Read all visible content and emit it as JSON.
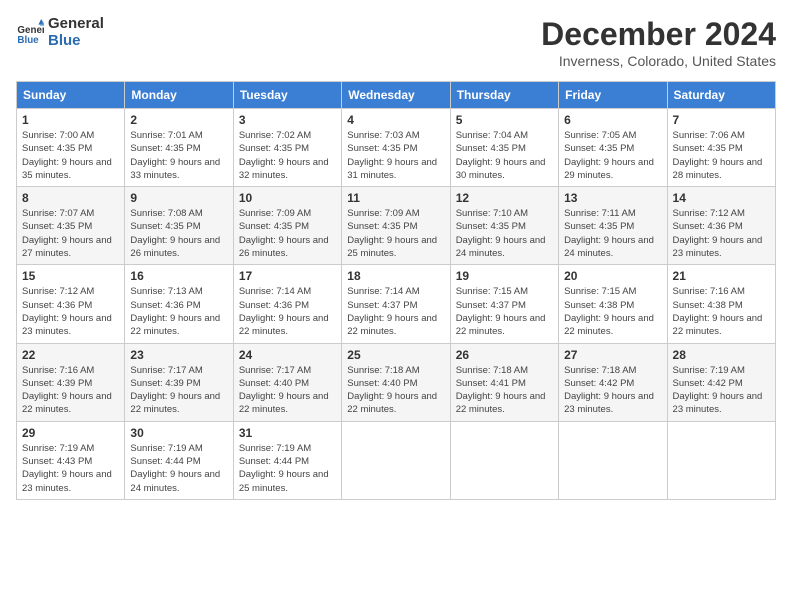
{
  "header": {
    "logo_line1": "General",
    "logo_line2": "Blue",
    "month": "December 2024",
    "location": "Inverness, Colorado, United States"
  },
  "weekdays": [
    "Sunday",
    "Monday",
    "Tuesday",
    "Wednesday",
    "Thursday",
    "Friday",
    "Saturday"
  ],
  "weeks": [
    [
      {
        "day": 1,
        "sunrise": "7:00 AM",
        "sunset": "4:35 PM",
        "daylight": "9 hours and 35 minutes."
      },
      {
        "day": 2,
        "sunrise": "7:01 AM",
        "sunset": "4:35 PM",
        "daylight": "9 hours and 33 minutes."
      },
      {
        "day": 3,
        "sunrise": "7:02 AM",
        "sunset": "4:35 PM",
        "daylight": "9 hours and 32 minutes."
      },
      {
        "day": 4,
        "sunrise": "7:03 AM",
        "sunset": "4:35 PM",
        "daylight": "9 hours and 31 minutes."
      },
      {
        "day": 5,
        "sunrise": "7:04 AM",
        "sunset": "4:35 PM",
        "daylight": "9 hours and 30 minutes."
      },
      {
        "day": 6,
        "sunrise": "7:05 AM",
        "sunset": "4:35 PM",
        "daylight": "9 hours and 29 minutes."
      },
      {
        "day": 7,
        "sunrise": "7:06 AM",
        "sunset": "4:35 PM",
        "daylight": "9 hours and 28 minutes."
      }
    ],
    [
      {
        "day": 8,
        "sunrise": "7:07 AM",
        "sunset": "4:35 PM",
        "daylight": "9 hours and 27 minutes."
      },
      {
        "day": 9,
        "sunrise": "7:08 AM",
        "sunset": "4:35 PM",
        "daylight": "9 hours and 26 minutes."
      },
      {
        "day": 10,
        "sunrise": "7:09 AM",
        "sunset": "4:35 PM",
        "daylight": "9 hours and 26 minutes."
      },
      {
        "day": 11,
        "sunrise": "7:09 AM",
        "sunset": "4:35 PM",
        "daylight": "9 hours and 25 minutes."
      },
      {
        "day": 12,
        "sunrise": "7:10 AM",
        "sunset": "4:35 PM",
        "daylight": "9 hours and 24 minutes."
      },
      {
        "day": 13,
        "sunrise": "7:11 AM",
        "sunset": "4:35 PM",
        "daylight": "9 hours and 24 minutes."
      },
      {
        "day": 14,
        "sunrise": "7:12 AM",
        "sunset": "4:36 PM",
        "daylight": "9 hours and 23 minutes."
      }
    ],
    [
      {
        "day": 15,
        "sunrise": "7:12 AM",
        "sunset": "4:36 PM",
        "daylight": "9 hours and 23 minutes."
      },
      {
        "day": 16,
        "sunrise": "7:13 AM",
        "sunset": "4:36 PM",
        "daylight": "9 hours and 22 minutes."
      },
      {
        "day": 17,
        "sunrise": "7:14 AM",
        "sunset": "4:36 PM",
        "daylight": "9 hours and 22 minutes."
      },
      {
        "day": 18,
        "sunrise": "7:14 AM",
        "sunset": "4:37 PM",
        "daylight": "9 hours and 22 minutes."
      },
      {
        "day": 19,
        "sunrise": "7:15 AM",
        "sunset": "4:37 PM",
        "daylight": "9 hours and 22 minutes."
      },
      {
        "day": 20,
        "sunrise": "7:15 AM",
        "sunset": "4:38 PM",
        "daylight": "9 hours and 22 minutes."
      },
      {
        "day": 21,
        "sunrise": "7:16 AM",
        "sunset": "4:38 PM",
        "daylight": "9 hours and 22 minutes."
      }
    ],
    [
      {
        "day": 22,
        "sunrise": "7:16 AM",
        "sunset": "4:39 PM",
        "daylight": "9 hours and 22 minutes."
      },
      {
        "day": 23,
        "sunrise": "7:17 AM",
        "sunset": "4:39 PM",
        "daylight": "9 hours and 22 minutes."
      },
      {
        "day": 24,
        "sunrise": "7:17 AM",
        "sunset": "4:40 PM",
        "daylight": "9 hours and 22 minutes."
      },
      {
        "day": 25,
        "sunrise": "7:18 AM",
        "sunset": "4:40 PM",
        "daylight": "9 hours and 22 minutes."
      },
      {
        "day": 26,
        "sunrise": "7:18 AM",
        "sunset": "4:41 PM",
        "daylight": "9 hours and 22 minutes."
      },
      {
        "day": 27,
        "sunrise": "7:18 AM",
        "sunset": "4:42 PM",
        "daylight": "9 hours and 23 minutes."
      },
      {
        "day": 28,
        "sunrise": "7:19 AM",
        "sunset": "4:42 PM",
        "daylight": "9 hours and 23 minutes."
      }
    ],
    [
      {
        "day": 29,
        "sunrise": "7:19 AM",
        "sunset": "4:43 PM",
        "daylight": "9 hours and 23 minutes."
      },
      {
        "day": 30,
        "sunrise": "7:19 AM",
        "sunset": "4:44 PM",
        "daylight": "9 hours and 24 minutes."
      },
      {
        "day": 31,
        "sunrise": "7:19 AM",
        "sunset": "4:44 PM",
        "daylight": "9 hours and 25 minutes."
      },
      null,
      null,
      null,
      null
    ]
  ]
}
